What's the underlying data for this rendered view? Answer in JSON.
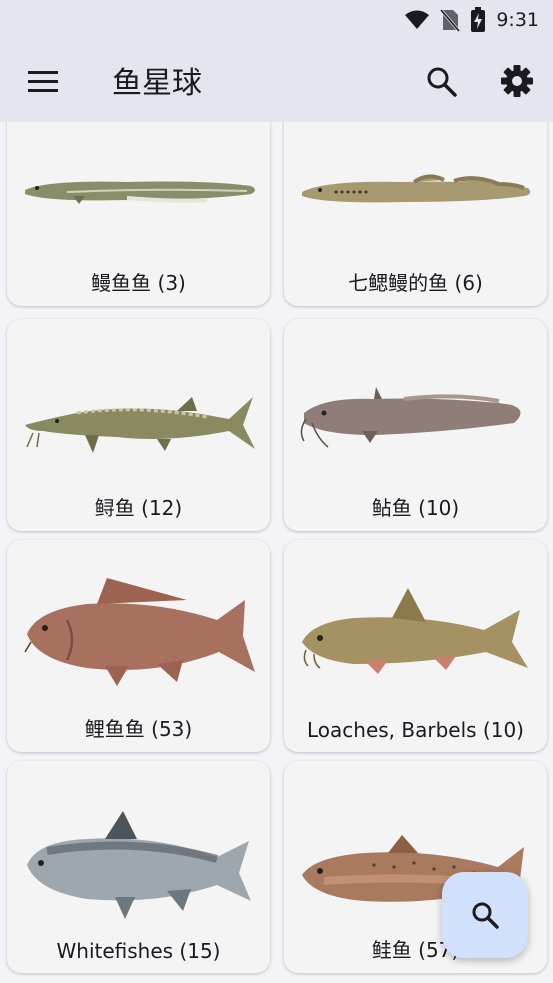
{
  "status_bar": {
    "time": "9:31"
  },
  "app_bar": {
    "title": "鱼星球"
  },
  "categories": [
    {
      "label": "鳗鱼鱼 (3)"
    },
    {
      "label": "七鳃鳗的鱼 (6)"
    },
    {
      "label": "鲟鱼 (12)"
    },
    {
      "label": "鲇鱼 (10)"
    },
    {
      "label": "鲤鱼鱼 (53)"
    },
    {
      "label": "Loaches, Barbels (10)"
    },
    {
      "label": "Whitefishes (15)"
    },
    {
      "label": "鲑鱼 (57)"
    }
  ]
}
